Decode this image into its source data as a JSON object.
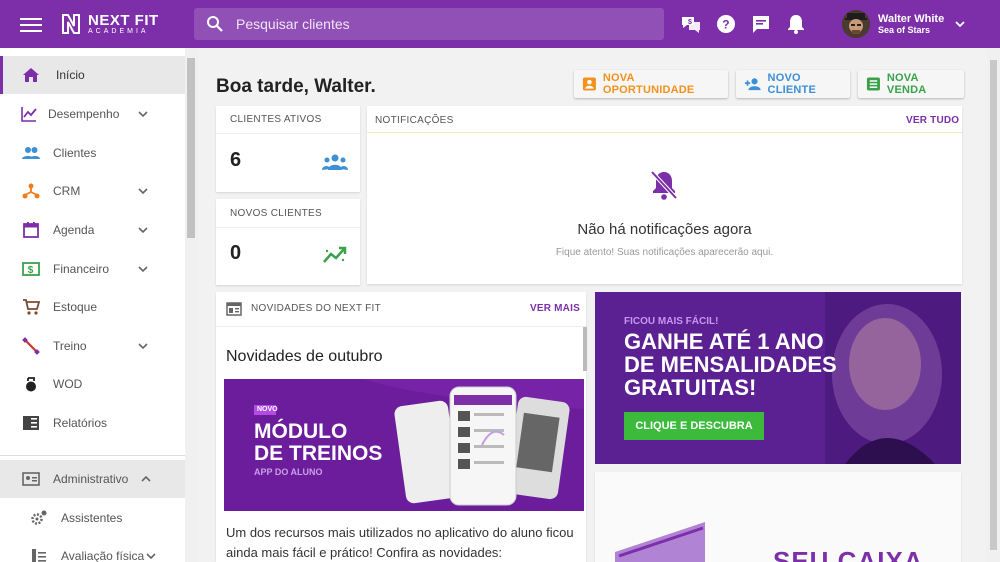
{
  "app": {
    "logo_name": "NEXT FIT",
    "logo_sub": "ACADEMIA",
    "search_placeholder": "Pesquisar clientes",
    "user_name": "Walter White",
    "user_sub": "Sea of Stars",
    "brand_color": "#7c2fa8"
  },
  "sidebar": {
    "items": [
      {
        "label": "Início",
        "icon": "home-icon",
        "color": "#7c2fa8"
      },
      {
        "label": "Desempenho",
        "icon": "chart-line-icon",
        "color": "#7c2fa8"
      },
      {
        "label": "Clientes",
        "icon": "users-icon",
        "color": "#3d8fd6"
      },
      {
        "label": "CRM",
        "icon": "crm-icon",
        "color": "#f07d1b"
      },
      {
        "label": "Agenda",
        "icon": "calendar-icon",
        "color": "#7c2fa8"
      },
      {
        "label": "Financeiro",
        "icon": "money-icon",
        "color": "#3aa14b"
      },
      {
        "label": "Estoque",
        "icon": "cart-icon",
        "color": "#7b4a33"
      },
      {
        "label": "Treino",
        "icon": "training-icon",
        "color": "#d0342c"
      },
      {
        "label": "WOD",
        "icon": "kettlebell-icon",
        "color": "#222222"
      },
      {
        "label": "Relatórios",
        "icon": "reports-icon",
        "color": "#444444"
      },
      {
        "label": "Administrativo",
        "icon": "id-card-icon",
        "color": "#666666"
      },
      {
        "label": "Assistentes",
        "icon": "gears-icon",
        "color": "#666666"
      },
      {
        "label": "Avaliação física",
        "icon": "evaluation-icon",
        "color": "#666666"
      }
    ]
  },
  "main": {
    "greeting": "Boa tarde, Walter.",
    "buttons": {
      "opportunity": "NOVA OPORTUNIDADE",
      "client": "NOVO CLIENTE",
      "sale": "NOVA VENDA"
    },
    "stats": {
      "active_label": "CLIENTES ATIVOS",
      "active_value": "6",
      "new_label": "NOVOS CLIENTES",
      "new_value": "0"
    },
    "notifications": {
      "header": "NOTIFICAÇÕES",
      "see_all": "VER TUDO",
      "empty_title": "Não há notificações agora",
      "empty_sub": "Fique atento! Suas notificações aparecerão aqui."
    },
    "news": {
      "header": "NOVIDADES DO NEXT FIT",
      "see_more": "VER MAIS",
      "title": "Novidades de outubro",
      "banner_tag": "NOVO",
      "banner_line1": "MÓDULO",
      "banner_line2": "DE TREINOS",
      "banner_line3": "APP DO ALUNO",
      "text": "Um dos recursos mais utilizados no aplicativo do aluno ficou ainda mais fácil e prático! Confira as novidades:"
    },
    "promo": {
      "tag": "FICOU MAIS FÁCIL!",
      "line1": "GANHE ATÉ 1 ANO",
      "line2": "DE MENSALIDADES",
      "line3": "GRATUITAS!",
      "cta": "CLIQUE E DESCUBRA",
      "second_text": "SEU CAIXA"
    }
  }
}
